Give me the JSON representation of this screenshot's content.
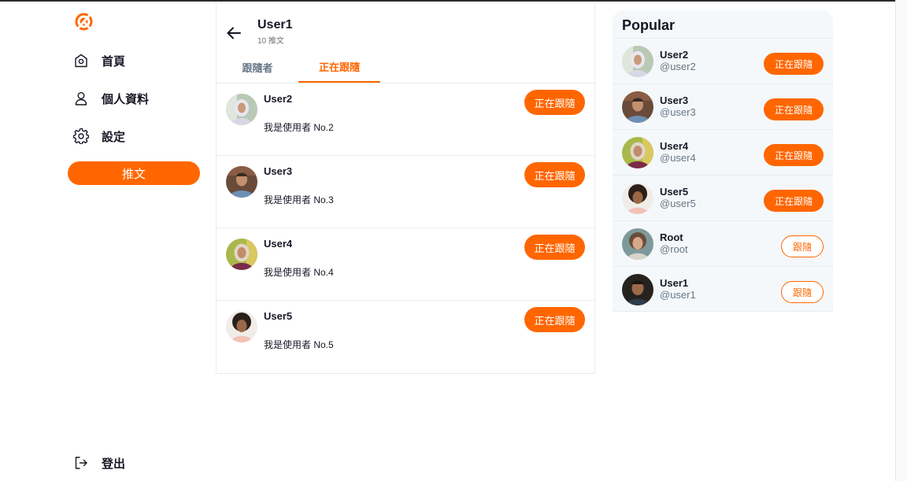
{
  "colors": {
    "accent": "#ff6600",
    "muted": "#657786",
    "text": "#171725"
  },
  "nav": {
    "logo_icon": "brand-logo-icon",
    "items": [
      {
        "label": "首頁",
        "icon": "home-icon"
      },
      {
        "label": "個人資料",
        "icon": "user-icon"
      },
      {
        "label": "設定",
        "icon": "gear-icon"
      }
    ],
    "tweet_button": "推文",
    "logout": {
      "label": "登出",
      "icon": "logout-icon"
    }
  },
  "header": {
    "name": "User1",
    "tweet_count": "10 推文"
  },
  "tabs": [
    {
      "label": "跟隨者",
      "active": false
    },
    {
      "label": "正在跟隨",
      "active": true
    }
  ],
  "following": [
    {
      "name": "User2",
      "bio": "我是使用者 No.2",
      "button": "正在跟隨"
    },
    {
      "name": "User3",
      "bio": "我是使用者 No.3",
      "button": "正在跟隨"
    },
    {
      "name": "User4",
      "bio": "我是使用者 No.4",
      "button": "正在跟隨"
    },
    {
      "name": "User5",
      "bio": "我是使用者 No.5",
      "button": "正在跟隨"
    }
  ],
  "popular": {
    "title": "Popular",
    "users": [
      {
        "name": "User2",
        "handle": "@user2",
        "button": "正在跟隨",
        "following": true
      },
      {
        "name": "User3",
        "handle": "@user3",
        "button": "正在跟隨",
        "following": true
      },
      {
        "name": "User4",
        "handle": "@user4",
        "button": "正在跟隨",
        "following": true
      },
      {
        "name": "User5",
        "handle": "@user5",
        "button": "正在跟隨",
        "following": true
      },
      {
        "name": "Root",
        "handle": "@root",
        "button": "跟隨",
        "following": false
      },
      {
        "name": "User1",
        "handle": "@user1",
        "button": "跟隨",
        "following": false
      }
    ]
  }
}
